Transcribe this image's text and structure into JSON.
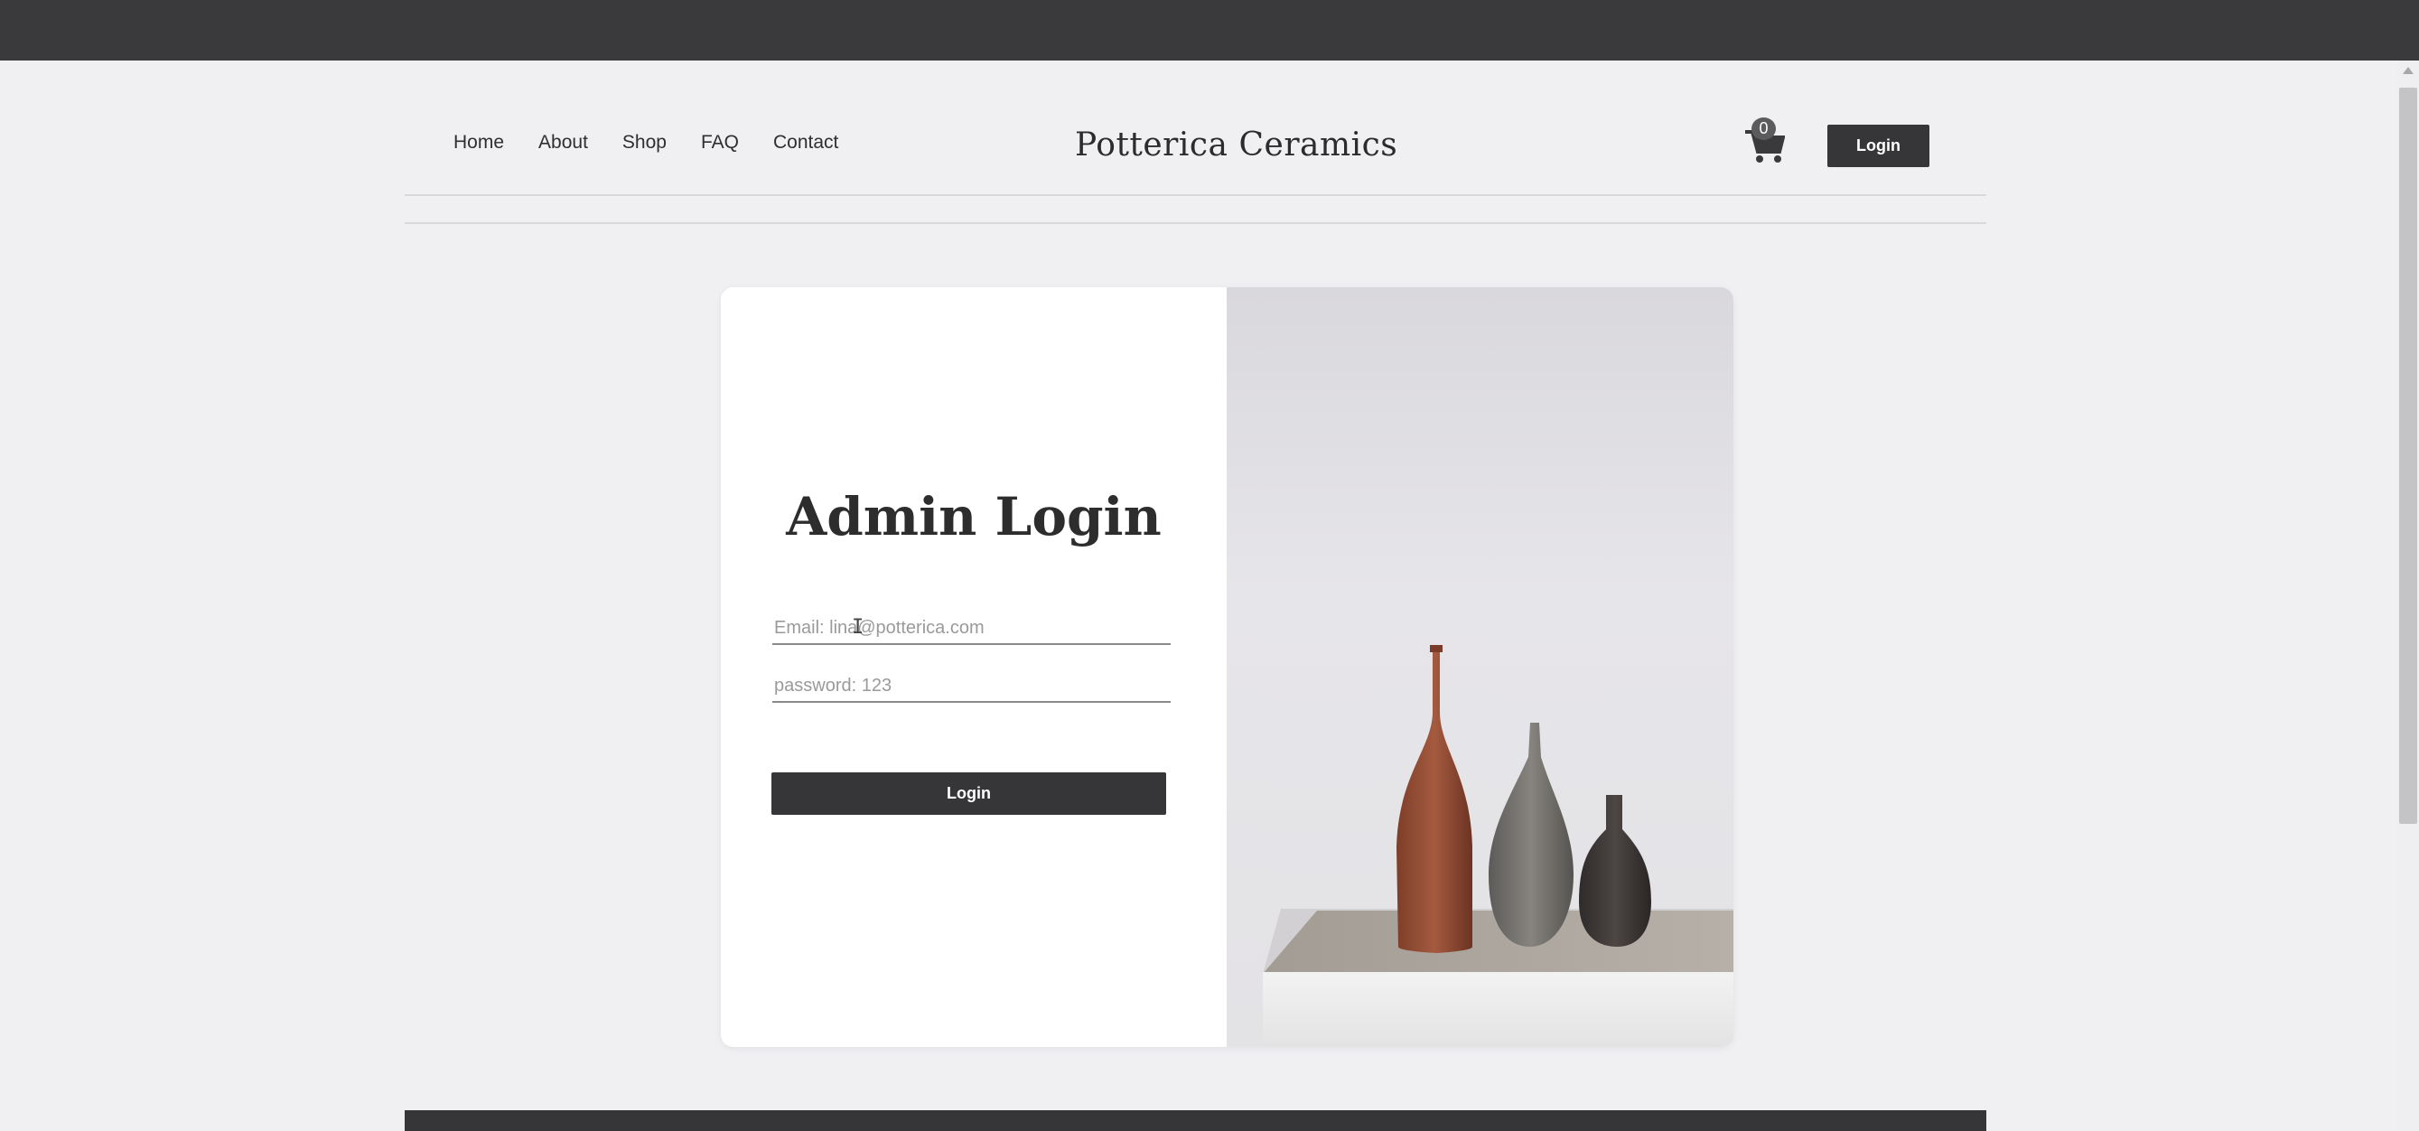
{
  "nav": {
    "items": [
      "Home",
      "About",
      "Shop",
      "FAQ",
      "Contact"
    ]
  },
  "brand": {
    "name": "Potterica Ceramics"
  },
  "cart": {
    "count": "0",
    "icon": "cart-icon"
  },
  "header": {
    "login_label": "Login"
  },
  "login_form": {
    "title": "Admin Login",
    "email_placeholder": "Email: lina@potterica.com",
    "password_placeholder": "password: 123",
    "submit_label": "Login"
  },
  "image": {
    "icon": "vases-photo"
  },
  "colors": {
    "dark": "#363537",
    "background": "#f0eff2",
    "card": "#ffffff"
  }
}
